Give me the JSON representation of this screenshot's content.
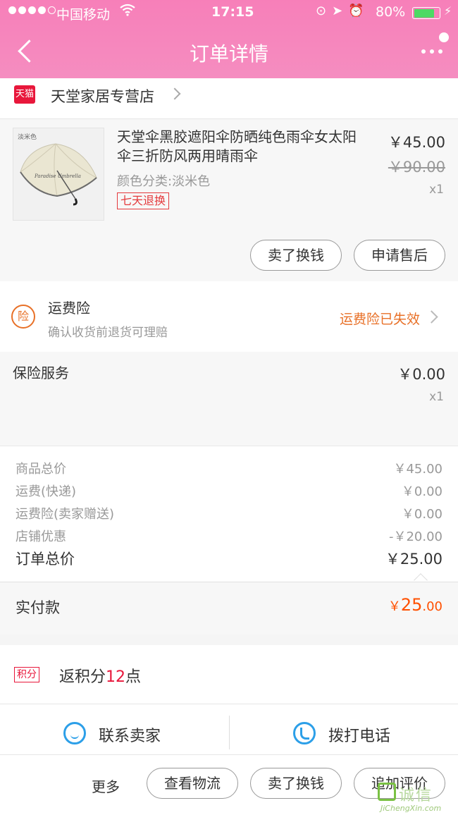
{
  "status_bar": {
    "carrier": "中国移动",
    "time": "17:15",
    "battery": "80%",
    "battery_level": 0.8
  },
  "nav": {
    "title": "订单详情"
  },
  "shop": {
    "badge": "天猫",
    "name": "天堂家居专营店"
  },
  "product": {
    "image_tag": "淡米色",
    "title": "天堂伞黑胶遮阳伞防晒纯色雨伞女太阳伞三折防风两用晴雨伞",
    "spec": "颜色分类:淡米色",
    "return_policy": "七天退换",
    "price": "￥45.00",
    "original_price": "￥90.00",
    "quantity": "x1",
    "actions": [
      "卖了换钱",
      "申请售后"
    ]
  },
  "shipping_insurance": {
    "icon_text": "险",
    "title": "运费险",
    "subtitle": "确认收货前退货可理赔",
    "status": "运费险已失效"
  },
  "insurance_service": {
    "label": "保险服务",
    "price": "￥0.00",
    "quantity": "x1"
  },
  "summary": {
    "rows": [
      {
        "label": "商品总价",
        "value": "￥45.00"
      },
      {
        "label": "运费(快递)",
        "value": "￥0.00"
      },
      {
        "label": "运费险(卖家赠送)",
        "value": "￥0.00"
      },
      {
        "label": "店铺优惠",
        "value": "-￥20.00"
      }
    ],
    "total_label": "订单总价",
    "total_value": "￥25.00"
  },
  "paid": {
    "label": "实付款",
    "currency": "￥",
    "integer": "25",
    "decimal": ".00"
  },
  "points": {
    "badge": "积分",
    "prefix": "返积分",
    "amount": "12",
    "suffix": "点"
  },
  "contact": {
    "seller": "联系卖家",
    "phone": "拨打电话"
  },
  "bottom_bar": {
    "more": "更多",
    "buttons": [
      "查看物流",
      "卖了换钱",
      "追加评价"
    ]
  },
  "watermark": {
    "text_cn": "诚信",
    "text_en": "JiChengXin.com"
  },
  "colors": {
    "nav_pink": "#f77fb9",
    "tmall_red": "#e8173b",
    "orange": "#ff5000",
    "contact_blue": "#2c9fe8"
  }
}
